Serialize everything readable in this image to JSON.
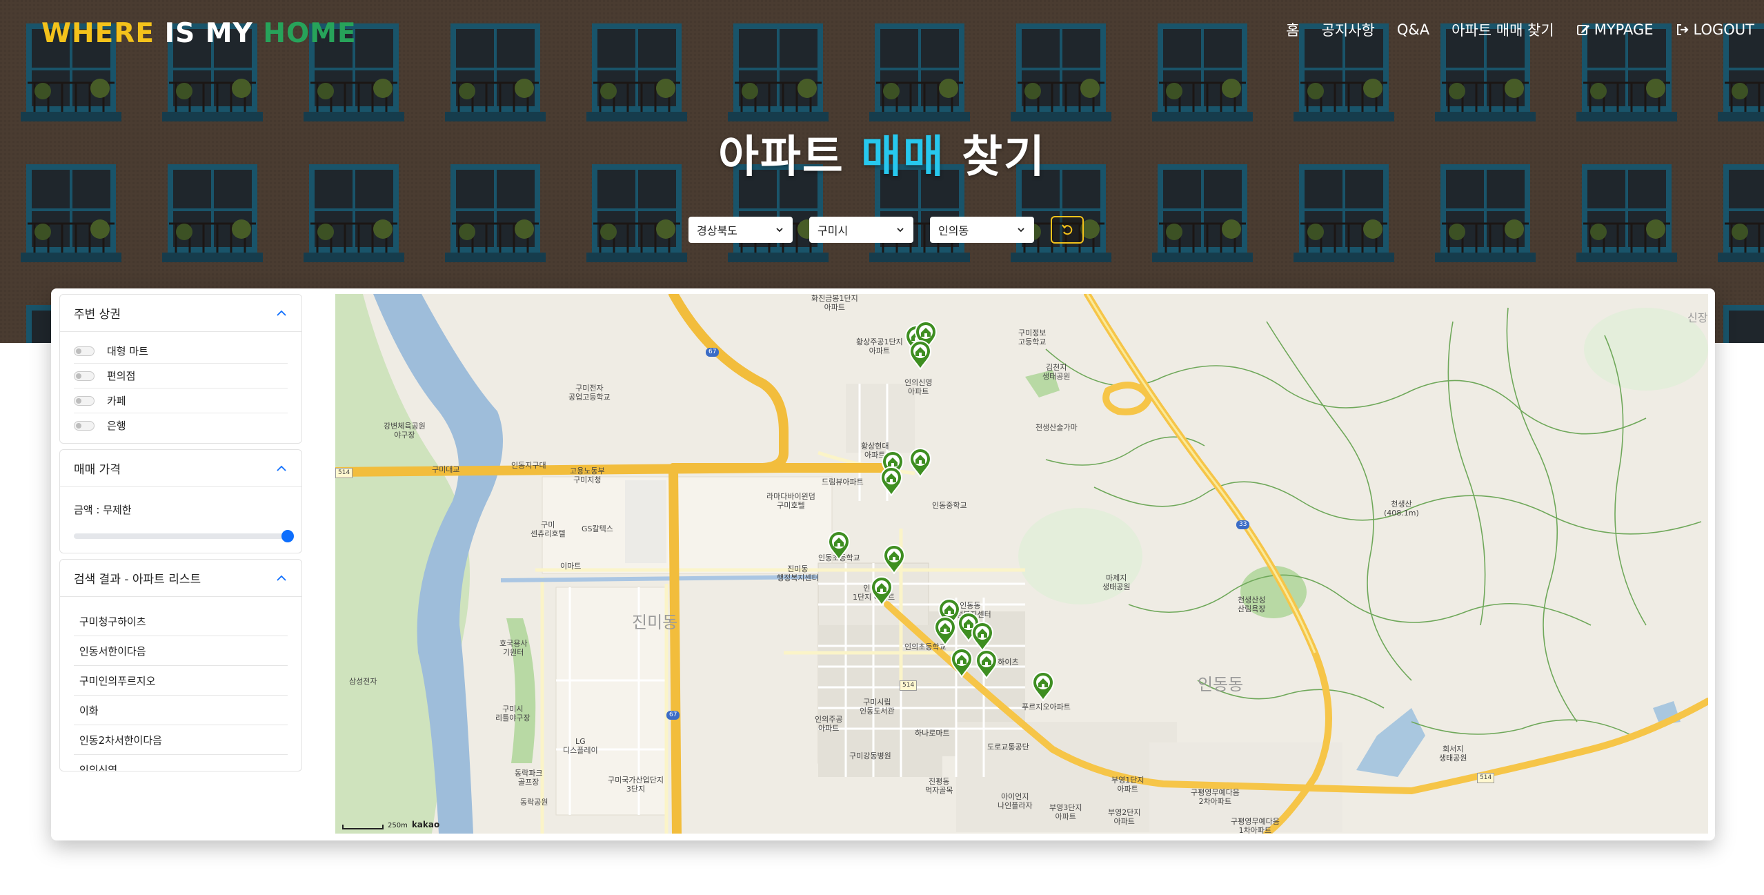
{
  "header": {
    "logo": {
      "part1": "WHERE",
      "part2": "IS MY",
      "part3": "HOME"
    },
    "nav": [
      {
        "label": "홈"
      },
      {
        "label": "공지사항"
      },
      {
        "label": "Q&A"
      },
      {
        "label": "아파트 매매 찾기"
      },
      {
        "label": "MYPAGE",
        "icon": "edit-icon"
      },
      {
        "label": "LOGOUT",
        "icon": "logout-icon"
      }
    ]
  },
  "hero": {
    "title_before": "아파트",
    "title_accent": "매매",
    "title_after": "찾기",
    "selects": {
      "sido": "경상북도",
      "gugun": "구미시",
      "dong": "인의동"
    },
    "reset_icon": "refresh-icon"
  },
  "sidebar": {
    "amenities": {
      "title": "주변 상권",
      "items": [
        {
          "label": "대형 마트"
        },
        {
          "label": "편의점"
        },
        {
          "label": "카페"
        },
        {
          "label": "은행"
        }
      ]
    },
    "price": {
      "title": "매매 가격",
      "label": "금액 : 무제한",
      "value_fraction": 1.0
    },
    "results": {
      "title": "검색 결과 - 아파트 리스트",
      "items": [
        "구미청구하이츠",
        "인동서한이다음",
        "구미인의푸르지오",
        "이화",
        "인동2차서한이다음",
        "인의신영"
      ]
    }
  },
  "map": {
    "labels": {
      "a1": "화진금봉1단지\n아파트",
      "a2": "구미전자\n공업고등학교",
      "a3": "구미정보\n고등학교",
      "a4": "강변체육공원\n야구장",
      "a5": "황상주공1단지\n아파트",
      "a6": "인의신영\n아파트",
      "a7": "김천지\n생태공원",
      "a8": "천생산술가마",
      "a9": "인동지구대",
      "a10": "고용노동부\n구미지청",
      "a11": "황상현대\n아파트",
      "a12": "라마다바이윈덤\n구미호텔",
      "a13": "드림뷰아파트",
      "a14": "인동중학교",
      "a15": "구미\n센츄리호텔",
      "a16": "GS칼텍스",
      "a17": "이마트",
      "a18": "진미동\n행정복지센터",
      "a19": "인동초등학교",
      "a20": "인동신\n1단지 아파트",
      "a21": "인동동\n행정복지센터",
      "a22": "인의초등학교",
      "a23": "마제지\n생태공원",
      "a24": "천생산성\n산림욕장",
      "a25": "천생산\n(408.1m)",
      "a26": "호국용사\n기원터",
      "a27": "삼성전자",
      "a28": "구미시\n리틀야구장",
      "a29": "LG\n디스플레이",
      "a30": "동락파크\n골프장",
      "a31": "동락공원",
      "a32": "구미국가산업단지\n3단지",
      "a33": "인의주공\n아파트",
      "a34": "구미시립\n인동도서관",
      "a35": "하나로마트",
      "a36": "도로교통공단",
      "a37": "구미강동병원",
      "a38": "진평동\n먹자골목",
      "a39": "아이언지\n나인플라자",
      "a40": "부영3단지\n아파트",
      "a41": "부영1단지\n아파트",
      "a42": "부영2단지\n아파트",
      "a43": "구평영무예다음\n2차아파트",
      "a44": "구평영무예다음\n1차아파트",
      "a45": "회서지\n생태공원",
      "a46": "구미대교",
      "a47": "푸르지오아파트",
      "a48": "인동하이츠",
      "big1": "진미동",
      "big2": "인동동",
      "r67": "67",
      "r514": "514",
      "r33": "33",
      "corner": "신장"
    },
    "scale": "250m",
    "brand": "kakao",
    "road_color": "#f6c548",
    "pin_color": "#3e8e21"
  }
}
